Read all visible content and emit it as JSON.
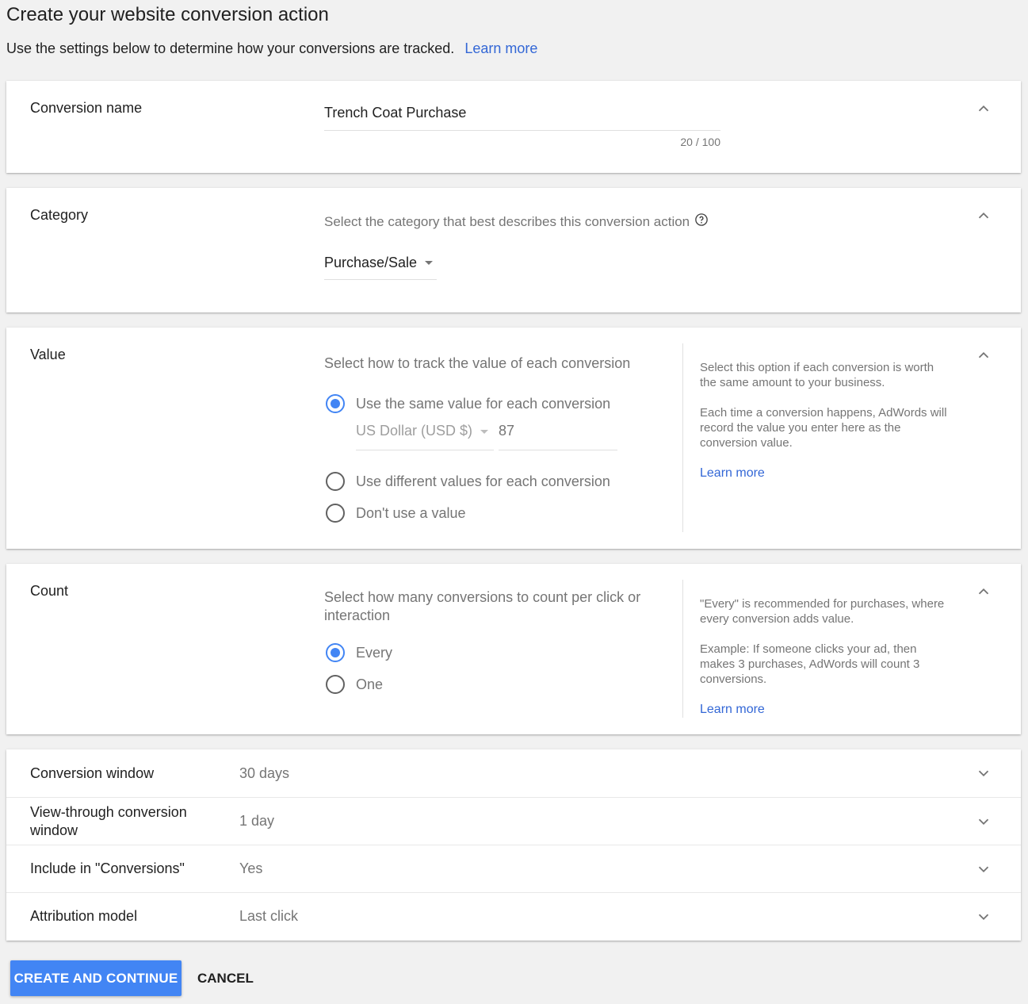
{
  "header": {
    "title": "Create your website conversion action",
    "subtitle": "Use the settings below to determine how your conversions are tracked.",
    "learn_more": "Learn more"
  },
  "conversion_name": {
    "label": "Conversion name",
    "value": "Trench Coat Purchase",
    "char_count": "20 / 100"
  },
  "category": {
    "label": "Category",
    "prompt": "Select the category that best describes this conversion action",
    "selected": "Purchase/Sale"
  },
  "value": {
    "label": "Value",
    "prompt": "Select how to track the value of each conversion",
    "options": [
      {
        "label": "Use the same value for each conversion",
        "checked": true
      },
      {
        "label": "Use different values for each conversion",
        "checked": false
      },
      {
        "label": "Don't use a value",
        "checked": false
      }
    ],
    "currency": "US Dollar (USD $)",
    "amount": "87",
    "help": [
      "Select this option if each conversion is worth the same amount to your business.",
      "Each time a conversion happens, AdWords will record the value you enter here as the conversion value."
    ],
    "learn_more": "Learn more"
  },
  "count": {
    "label": "Count",
    "prompt": "Select how many conversions to count per click or interaction",
    "options": [
      {
        "label": "Every",
        "checked": true
      },
      {
        "label": "One",
        "checked": false
      }
    ],
    "help": [
      "\"Every\" is recommended for purchases, where every conversion adds value.",
      "Example: If someone clicks your ad, then makes 3 purchases, AdWords will count 3 conversions."
    ],
    "learn_more": "Learn more"
  },
  "summary_rows": [
    {
      "label": "Conversion window",
      "value": "30 days"
    },
    {
      "label": "View-through conversion window",
      "value": "1 day"
    },
    {
      "label": "Include in \"Conversions\"",
      "value": "Yes"
    },
    {
      "label": "Attribution model",
      "value": "Last click"
    }
  ],
  "actions": {
    "primary": "CREATE AND CONTINUE",
    "cancel": "CANCEL"
  },
  "colors": {
    "accent": "#4285f4",
    "link": "#3367d6",
    "background": "#f1f1f1"
  },
  "icons": [
    "chevron-up-icon",
    "chevron-down-icon",
    "help-circle-icon",
    "dropdown-arrow-icon"
  ]
}
